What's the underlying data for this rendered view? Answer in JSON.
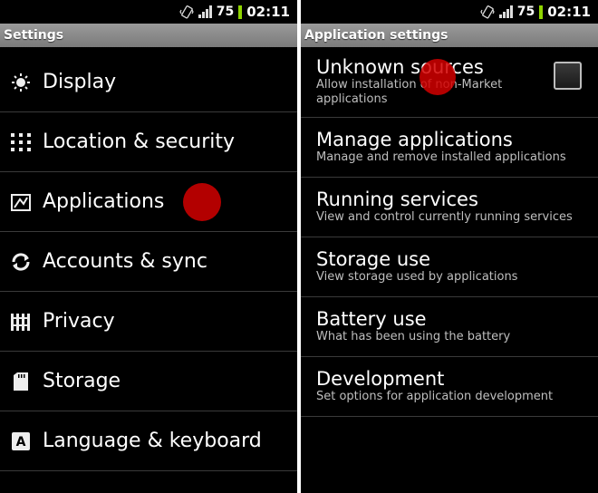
{
  "status": {
    "battery": "75",
    "time": "02:11"
  },
  "left": {
    "title": "Settings",
    "items": [
      {
        "label": "Display",
        "icon": "brightness-icon"
      },
      {
        "label": "Location & security",
        "icon": "grid-dots-icon"
      },
      {
        "label": "Applications",
        "icon": "applications-icon"
      },
      {
        "label": "Accounts & sync",
        "icon": "sync-icon"
      },
      {
        "label": "Privacy",
        "icon": "fence-icon"
      },
      {
        "label": "Storage",
        "icon": "sd-card-icon"
      },
      {
        "label": "Language & keyboard",
        "icon": "keyboard-a-icon"
      }
    ]
  },
  "right": {
    "title": "Application settings",
    "items": [
      {
        "title": "Unknown sources",
        "summary": "Allow installation of non-Market applications"
      },
      {
        "title": "Manage applications",
        "summary": "Manage and remove installed applications"
      },
      {
        "title": "Running services",
        "summary": "View and control currently running services"
      },
      {
        "title": "Storage use",
        "summary": "View storage used by applications"
      },
      {
        "title": "Battery use",
        "summary": "What has been using the battery"
      },
      {
        "title": "Development",
        "summary": "Set options for application development"
      }
    ]
  },
  "colors": {
    "tap_marker": "#d00000",
    "battery": "#8fd400"
  }
}
